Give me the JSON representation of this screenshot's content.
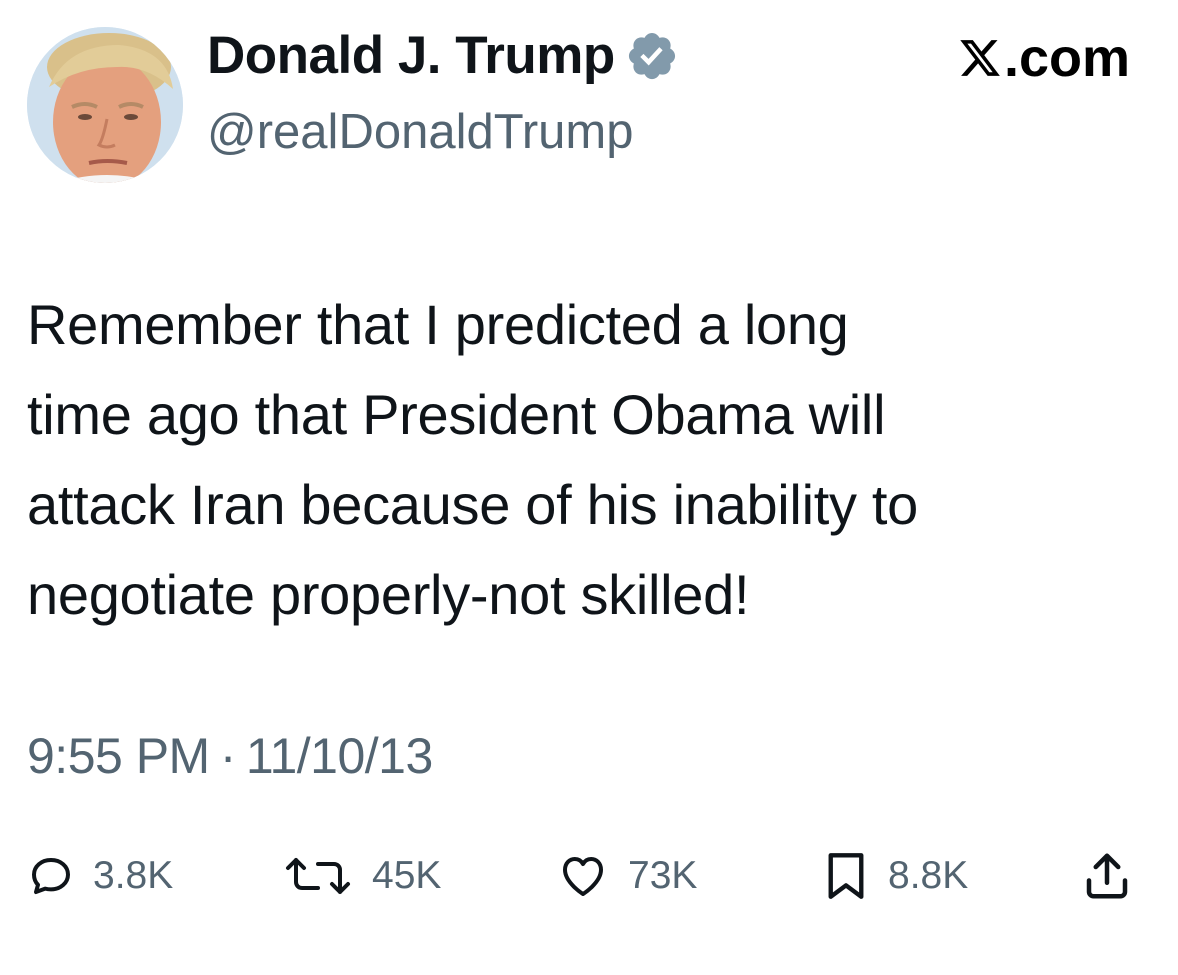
{
  "author": {
    "display_name": "Donald J. Trump",
    "handle": "@realDonaldTrump",
    "verified": true,
    "verified_color": "#829aab"
  },
  "brand": {
    "label": ".com"
  },
  "tweet": {
    "lines": [
      "Remember that I predicted a long",
      "time ago that President Obama will",
      "attack Iran because of his inability to",
      "negotiate properly-not skilled!"
    ],
    "time": "9:55 PM",
    "separator": "·",
    "date": "11/10/13"
  },
  "actions": {
    "replies": {
      "icon": "reply-icon",
      "count": "3.8K"
    },
    "reposts": {
      "icon": "repost-icon",
      "count": "45K"
    },
    "likes": {
      "icon": "heart-icon",
      "count": "73K"
    },
    "bookmarks": {
      "icon": "bookmark-icon",
      "count": "8.8K"
    },
    "share": {
      "icon": "share-icon"
    }
  },
  "colors": {
    "text": "#0f1419",
    "secondary": "#536471"
  }
}
